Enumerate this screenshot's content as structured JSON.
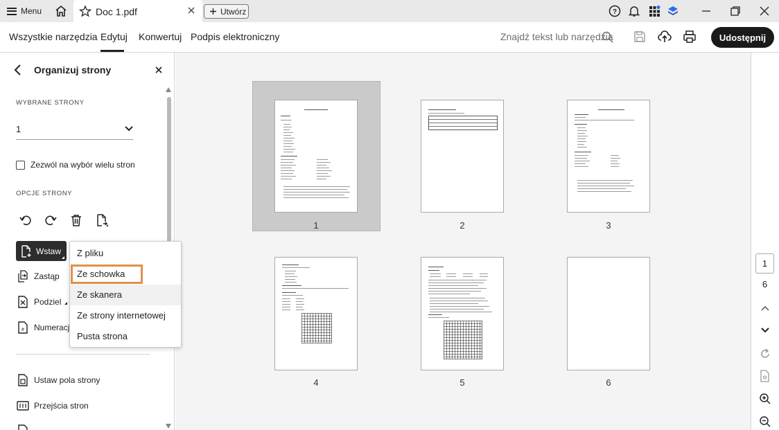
{
  "titlebar": {
    "menu_label": "Menu",
    "doc_tab_name": "Doc 1.pdf",
    "create_label": "Utwórz"
  },
  "toolbar": {
    "tabs": [
      "Wszystkie narzędzia",
      "Edytuj",
      "Konwertuj",
      "Podpis elektroniczny"
    ],
    "active_tab": "Edytuj",
    "search_placeholder": "Znajdź tekst lub narzędzia",
    "share_label": "Udostępnij"
  },
  "panel": {
    "title": "Organizuj strony",
    "selected_pages_label": "WYBRANE STRONY",
    "selected_page_value": "1",
    "multi_select_label": "Zezwól na wybór wielu stron",
    "page_options_label": "OPCJE STRONY",
    "items": {
      "insert": "Wstaw",
      "replace": "Zastąp",
      "split": "Podziel",
      "numbering": "Numeracj",
      "page_box": "Ustaw pola strony",
      "transitions": "Przejścia stron"
    }
  },
  "insert_menu": {
    "items": [
      "Z pliku",
      "Ze schowka",
      "Ze skanera",
      "Ze strony internetowej",
      "Pusta strona"
    ],
    "focused_item": "Ze schowka",
    "hovered_item": "Ze skanera"
  },
  "pages": {
    "labels": [
      "1",
      "2",
      "3",
      "4",
      "5",
      "6"
    ],
    "selected": "1"
  },
  "rail": {
    "current_page": "1",
    "total_pages": "6"
  },
  "colors": {
    "share_bg": "#1a1a1a",
    "focus_outline": "#e0914a",
    "selection_bg": "#cacaca"
  }
}
